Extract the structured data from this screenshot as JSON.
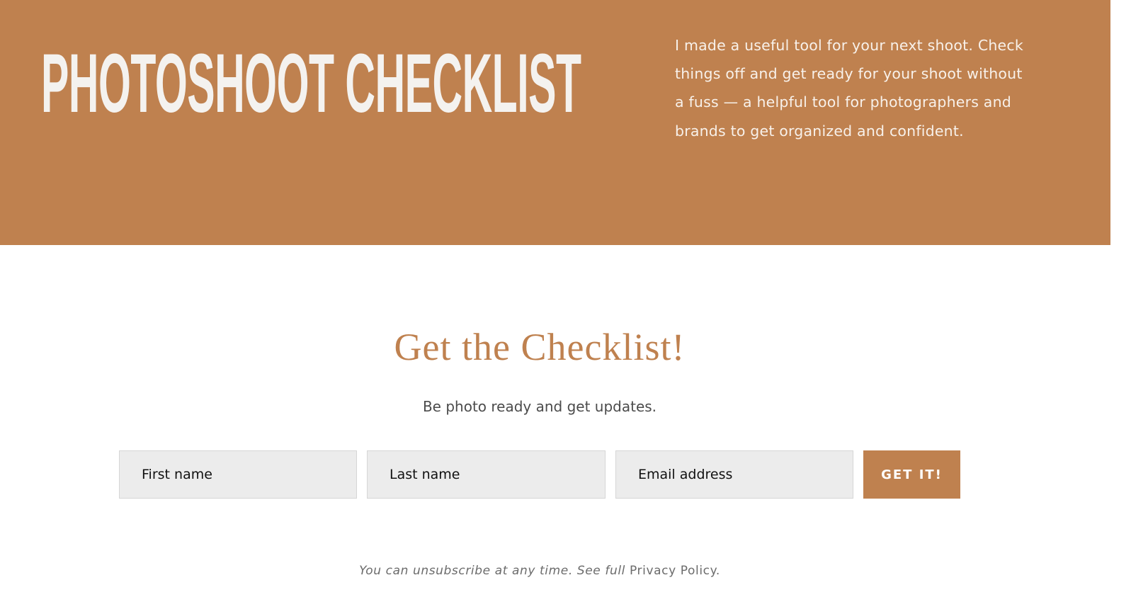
{
  "colors": {
    "accent": "#bf814f",
    "hero_text": "#f4f2ef",
    "field_background": "#ececec",
    "muted_text": "#6b6b6b"
  },
  "hero": {
    "title": "PHOTOSHOOT CHECKLIST",
    "description": "I made a useful tool for your next shoot. Check things off and get ready for your shoot without a fuss — a helpful tool for photographers and brands to get organized and confident."
  },
  "signup": {
    "heading": "Get the Checklist!",
    "subheading": "Be photo ready and get updates.",
    "form": {
      "first_name_placeholder": "First name",
      "last_name_placeholder": "Last name",
      "email_placeholder": "Email address",
      "submit_label": "GET IT!"
    },
    "privacy_note": "You can unsubscribe at any time. See full",
    "privacy_link_label": "Privacy Policy",
    "privacy_trailing": "."
  }
}
